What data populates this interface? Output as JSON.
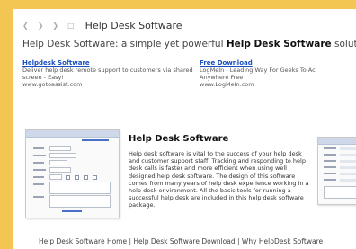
{
  "header": {
    "nav_icons": [
      "back-icon",
      "forward-icon",
      "forward-icon",
      "page-icon"
    ],
    "title": "Help Desk Software"
  },
  "tagline": {
    "prefix": "Help Desk Software: a simple yet powerful ",
    "bold": "Help Desk Software",
    "suffix": " solutio"
  },
  "ads": [
    {
      "title": "Helpdesk Software",
      "line1": "Deliver help desk remote support to customers via shared",
      "line2": "screen - Easy!",
      "url": "www.gotoassist.com"
    },
    {
      "title": "Free Download",
      "line1": "LogMeIn - Leading Way For Geeks To Ac",
      "line2": "Anywhere Free",
      "url": "www.LogMeIn.com"
    }
  ],
  "article": {
    "title": "Help Desk Software",
    "body": "Help desk software is vital to the success of your help desk and customer support staff. Tracking and responding to help desk calls is faster and more efficient when using well designed help desk software. The design of this software comes from many years of help desk experience working in a help desk environment. All the basic tools for running a successful help desk are included in this help desk software package."
  },
  "footer": {
    "text": "Help Desk Software Home | Help Desk Software Download | Why HelpDesk Software"
  },
  "colors": {
    "background": "#f3c552",
    "link": "#1a4fc0"
  }
}
